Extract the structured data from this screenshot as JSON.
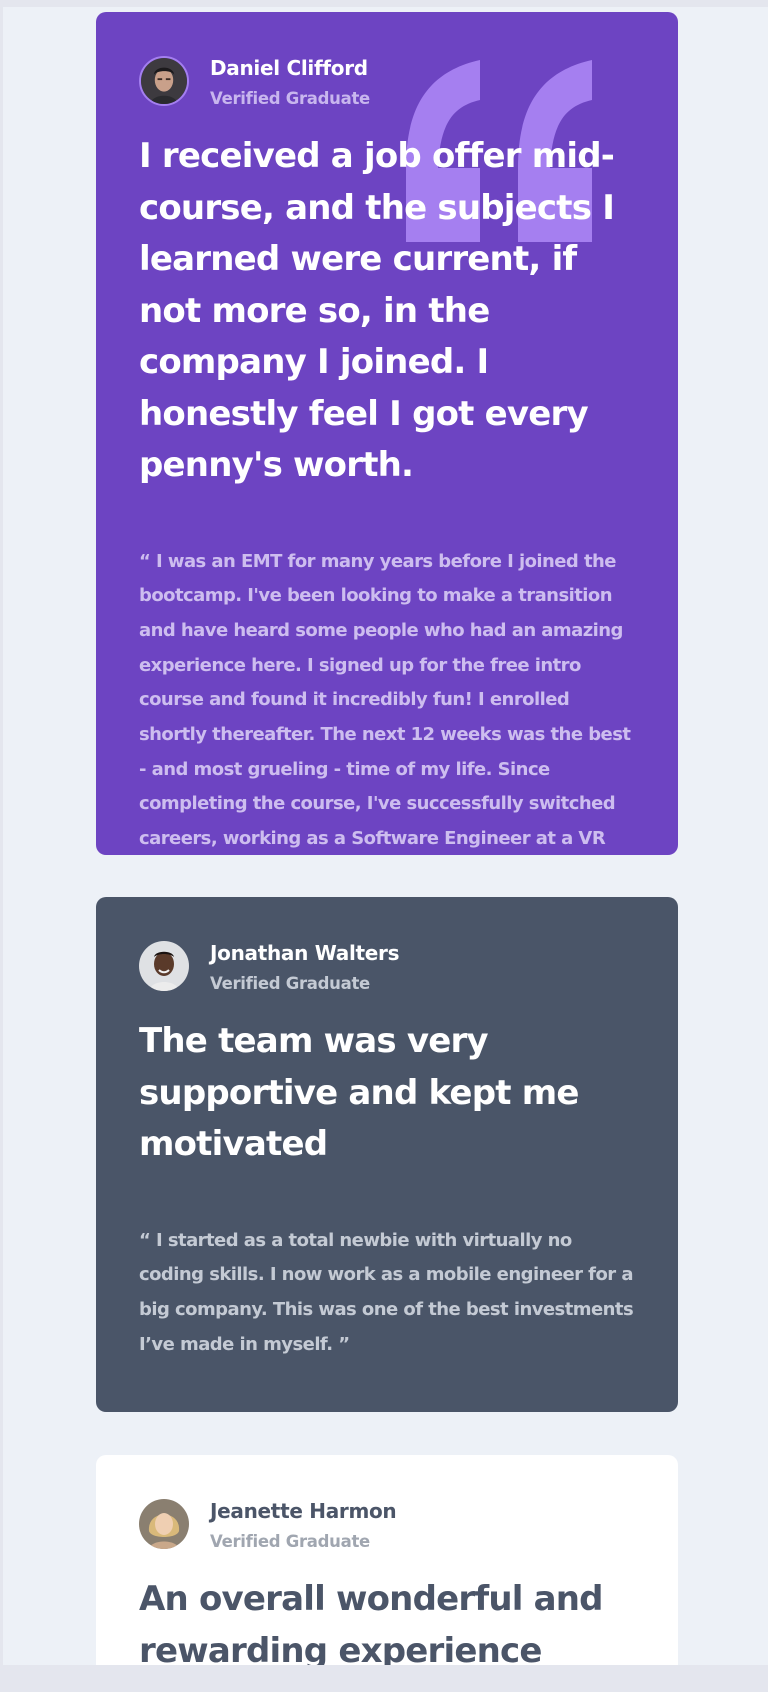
{
  "testimonials": [
    {
      "name": "Daniel Clifford",
      "status": "Verified Graduate",
      "headline": "I received a job offer mid-course, and the subjects I learned were current, if not more so, in the company I joined. I honestly feel I got every penny's worth.",
      "body": "“ I was an EMT for many years before I joined the bootcamp. I've been looking to make a transition and have heard some people who had an amazing experience here. I signed up for the free intro course and found it incredibly fun! I enrolled shortly thereafter. The next 12 weeks was the best - and most grueling - time of my life. Since completing the course, I've successfully switched careers, working as a Software Engineer at a VR startup. “",
      "bg_color": "#6d44c2"
    },
    {
      "name": "Jonathan Walters",
      "status": "Verified Graduate",
      "headline": "The team was very supportive and kept me motivated",
      "body": "“ I started as a total newbie with virtually no coding skills. I now work as a mobile engineer for a big company. This was one of the best investments I’ve made in myself. ”",
      "bg_color": "#4a5568"
    },
    {
      "name": "Jeanette Harmon",
      "status": "Verified Graduate",
      "headline": "An overall wonderful and rewarding experience",
      "bg_color": "#ffffff"
    }
  ],
  "icons": {
    "quote": "quote-icon",
    "avatar": "avatar"
  },
  "colors": {
    "page_bg": "#edf1f7",
    "quote_mark": "#a57ff0"
  }
}
